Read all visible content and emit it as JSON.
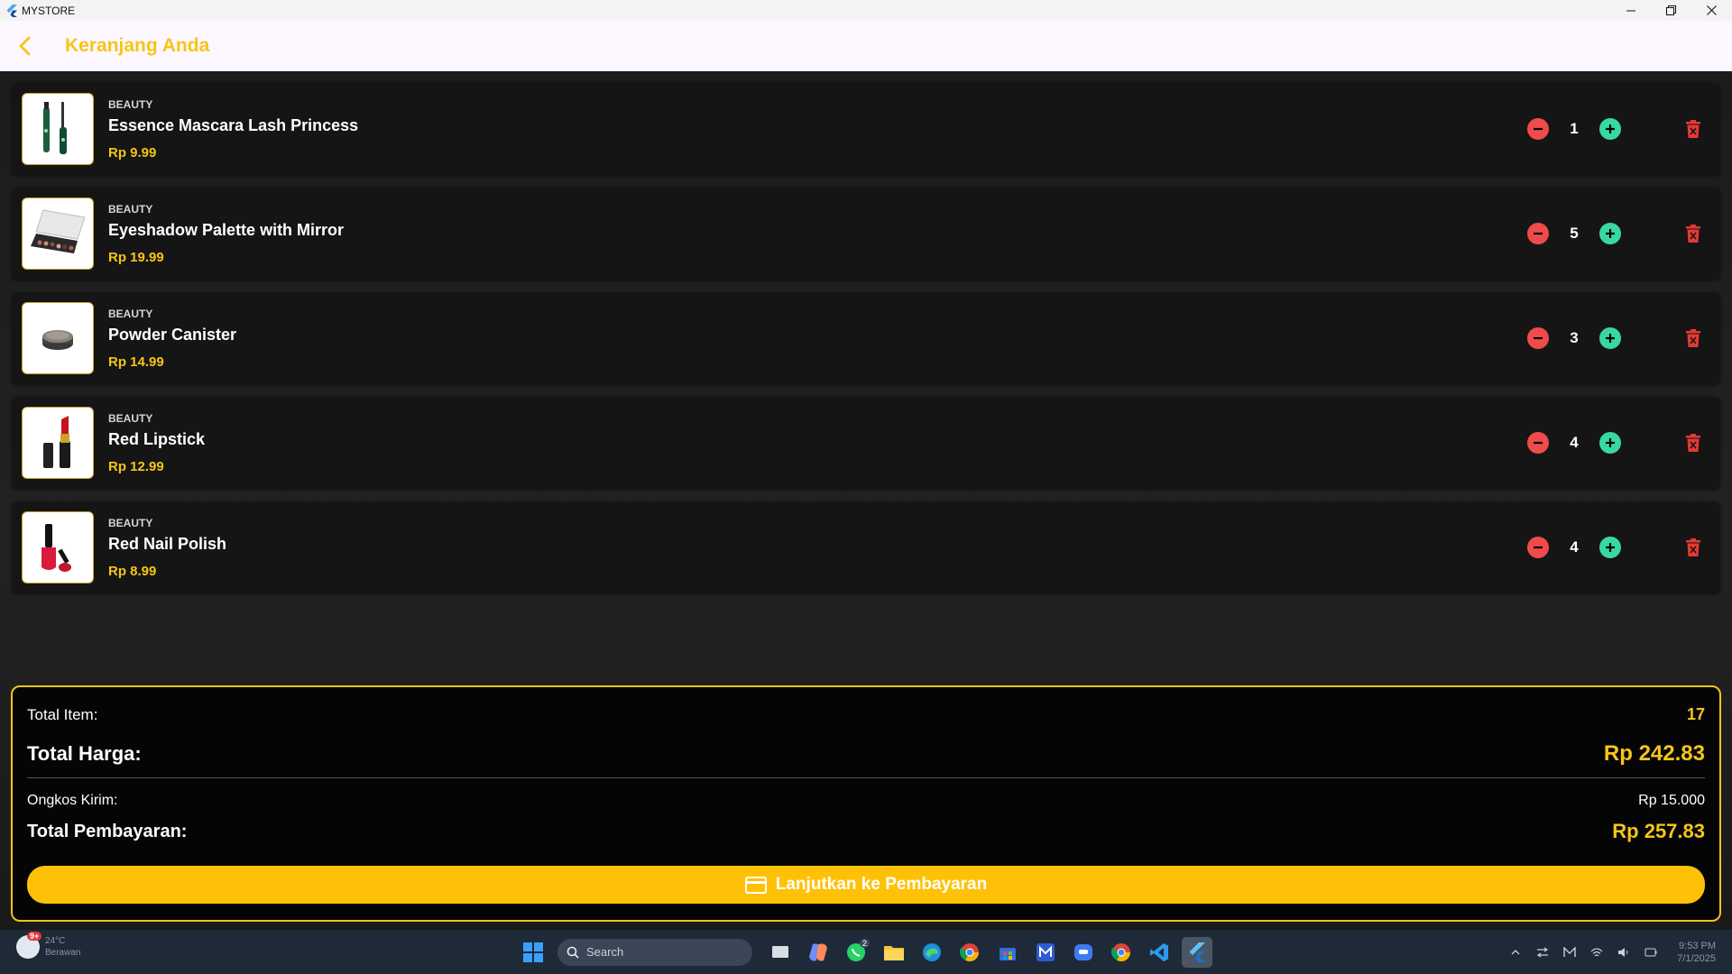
{
  "window": {
    "title": "MYSTORE",
    "minimize_symbol": "—",
    "close_symbol": "✕"
  },
  "appbar": {
    "title": "Keranjang Anda"
  },
  "cart": {
    "items": [
      {
        "category": "BEAUTY",
        "name": "Essence Mascara Lash Princess",
        "price": "Rp 9.99",
        "qty": "1",
        "image": "mascara"
      },
      {
        "category": "BEAUTY",
        "name": "Eyeshadow Palette with Mirror",
        "price": "Rp 19.99",
        "qty": "5",
        "image": "eyeshadow-palette"
      },
      {
        "category": "BEAUTY",
        "name": "Powder Canister",
        "price": "Rp 14.99",
        "qty": "3",
        "image": "powder-canister"
      },
      {
        "category": "BEAUTY",
        "name": "Red Lipstick",
        "price": "Rp 12.99",
        "qty": "4",
        "image": "lipstick"
      },
      {
        "category": "BEAUTY",
        "name": "Red Nail Polish",
        "price": "Rp 8.99",
        "qty": "4",
        "image": "nail-polish"
      }
    ]
  },
  "summary": {
    "total_item_label": "Total Item:",
    "total_item_value": "17",
    "total_harga_label": "Total Harga:",
    "total_harga_value": "Rp 242.83",
    "ongkos_label": "Ongkos Kirim:",
    "ongkos_value": "Rp 15.000",
    "total_bayar_label": "Total Pembayaran:",
    "total_bayar_value": "Rp 257.83",
    "pay_button_label": "Lanjutkan ke Pembayaran"
  },
  "taskbar": {
    "weather_temp": "24°C",
    "weather_desc": "Berawan",
    "weather_badge": "9+",
    "search_placeholder": "Search",
    "whatsapp_badge": "2",
    "time": "9:53 PM",
    "date": "7/1/2025"
  },
  "colors": {
    "accent": "#f5c518",
    "button": "#ffc107",
    "minus": "#f04b4b",
    "plus": "#38d9a0",
    "trash": "#e53935"
  }
}
